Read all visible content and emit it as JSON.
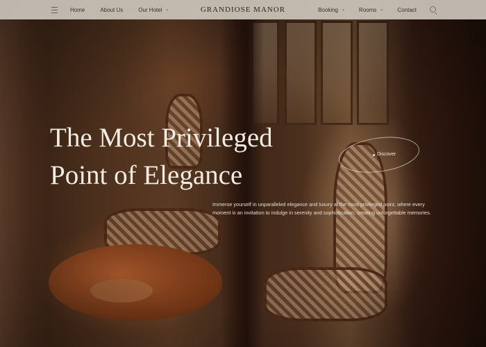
{
  "header": {
    "brand": "GRANDIOSE MANOR",
    "nav_left": [
      {
        "label": "Home",
        "has_dropdown": false
      },
      {
        "label": "About Us",
        "has_dropdown": false
      },
      {
        "label": "Our Hotel",
        "has_dropdown": true
      }
    ],
    "nav_right": [
      {
        "label": "Booking",
        "has_dropdown": true
      },
      {
        "label": "Rooms",
        "has_dropdown": true
      },
      {
        "label": "Contact",
        "has_dropdown": false
      }
    ],
    "icons": {
      "menu": "hamburger-icon",
      "search": "search-icon",
      "dropdown": "chevron-down-icon"
    }
  },
  "hero": {
    "title_line1": "The Most Privileged",
    "title_line2": "Point of Elegance",
    "description": "Immerse yourself in unparalleled elegance and luxury at the most privileged point, where every moment is an invitation to indulge in serenity and sophistication, creating unforgettable memories.",
    "cta_label": "Discover"
  },
  "colors": {
    "nav_bg": "#cdc6bc",
    "nav_text": "#3b302a",
    "hero_text": "#f3ece3",
    "background_wood": "#4a2e1c"
  }
}
